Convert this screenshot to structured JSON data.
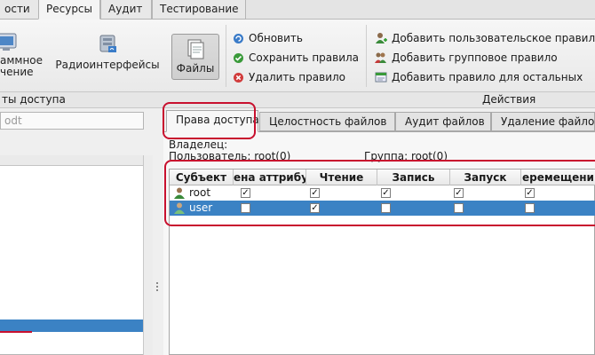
{
  "top_tabs": [
    {
      "label": "ости",
      "active": false
    },
    {
      "label": "Ресурсы",
      "active": true
    },
    {
      "label": "Аудит",
      "active": false
    },
    {
      "label": "Тестирование",
      "active": false
    }
  ],
  "ribbon": {
    "btn_program_line1": "аммное",
    "btn_program_line2": "чение",
    "btn_radio": "Радиоинтерфейсы",
    "btn_files": "Файлы",
    "refresh": "Обновить",
    "save_rules": "Сохранить правила",
    "delete_rule": "Удалить правило",
    "add_user_rule": "Добавить пользовательское правило",
    "add_group_rule": "Добавить групповое правило",
    "add_others_rule": "Добавить правило для остальных"
  },
  "section_labels": {
    "left": "ты доступа",
    "right": "Действия"
  },
  "left_search_text": "odt",
  "right_tabs": [
    {
      "label": "Права доступа",
      "active": true
    },
    {
      "label": "Целостность файлов",
      "active": false
    },
    {
      "label": "Аудит файлов",
      "active": false
    },
    {
      "label": "Удаление файлов",
      "active": false
    }
  ],
  "owner_label": "Владелец:",
  "user_line": "Пользователь: root(0)",
  "group_line": "Группа: root(0)",
  "table": {
    "columns": [
      "Субъект",
      "ена аттрибу",
      "Чтение",
      "Запись",
      "Запуск",
      "еремещени"
    ],
    "rows": [
      {
        "subject": "root",
        "selected": false,
        "checks": [
          true,
          true,
          true,
          true,
          true
        ]
      },
      {
        "subject": "user",
        "selected": true,
        "checks": [
          false,
          true,
          false,
          false,
          false
        ]
      }
    ]
  },
  "colors": {
    "selection": "#3b82c4",
    "highlight": "#c8102e",
    "green_icon": "#3a9a3a",
    "red_icon": "#d13b3b"
  }
}
